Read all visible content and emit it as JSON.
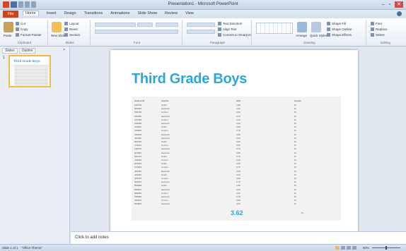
{
  "window": {
    "title": "Presentation1 - Microsoft PowerPoint",
    "controls": [
      "–",
      "▫",
      "✕"
    ]
  },
  "ribbon": {
    "file_tab": "File",
    "tabs": [
      "Home",
      "Insert",
      "Design",
      "Transitions",
      "Animations",
      "Slide Show",
      "Review",
      "View"
    ],
    "groups": {
      "clipboard": "Clipboard",
      "slides": "Slides",
      "font": "Font",
      "paragraph": "Paragraph",
      "drawing": "Drawing",
      "editing": "Editing"
    },
    "buttons": {
      "paste": "Paste",
      "cut": "Cut",
      "copy": "Copy",
      "format_painter": "Format Painter",
      "new_slide": "New Slide",
      "layout": "Layout",
      "reset": "Reset",
      "section": "Section",
      "text_direction": "Text Direction",
      "align_text": "Align Text",
      "convert_smartart": "Convert to SmartArt",
      "arrange": "Arrange",
      "quick_styles": "Quick Styles",
      "shape_fill": "Shape Fill",
      "shape_outline": "Shape Outline",
      "shape_effects": "Shape Effects",
      "find": "Find",
      "replace": "Replace",
      "select": "Select"
    }
  },
  "left_pane": {
    "tabs": [
      "Slides",
      "Outline"
    ],
    "close": "×",
    "slide_number": "1",
    "thumb_title": "Third Grade Boys"
  },
  "slide": {
    "title": "Third Grade Boys",
    "table": {
      "headers": [
        "Student ID",
        "Teacher",
        "GPA",
        "Gender"
      ],
      "rows": [
        [
          "128756",
          "Smith",
          "1.80",
          "M"
        ],
        [
          "854295",
          "Hancock",
          "4.00",
          "M"
        ],
        [
          "628786",
          "Conner",
          "3.80",
          "M"
        ],
        [
          "546085",
          "Hancock",
          "3.75",
          "M"
        ],
        [
          "247180",
          "Conner",
          "3.20",
          "M"
        ],
        [
          "229408",
          "Hancock",
          "4.00",
          "M"
        ],
        [
          "264852",
          "Smith",
          "3.80",
          "M"
        ],
        [
          "446853",
          "Conner",
          "3.75",
          "M"
        ],
        [
          "256608",
          "Hancock",
          "4.00",
          "M"
        ],
        [
          "462387",
          "Hancock",
          "3.20",
          "M"
        ],
        [
          "864236",
          "Smith",
          "3.80",
          "M"
        ],
        [
          "475623",
          "Conner",
          "3.80",
          "M"
        ],
        [
          "138752",
          "Hancock",
          "3.75",
          "M"
        ],
        [
          "907856",
          "Hancock",
          "3.80",
          "M"
        ],
        [
          "582475",
          "Smith",
          "3.75",
          "M"
        ],
        [
          "218683",
          "Conner",
          "3.20",
          "M"
        ],
        [
          "205463",
          "Smith",
          "4.00",
          "M"
        ],
        [
          "167863",
          "Conner",
          "3.75",
          "M"
        ],
        [
          "460585",
          "Hancock",
          "4.00",
          "M"
        ],
        [
          "243486",
          "Smith",
          "3.20",
          "M"
        ],
        [
          "464378",
          "Conner",
          "3.80",
          "M"
        ],
        [
          "864676",
          "Hancock",
          "3.75",
          "M"
        ],
        [
          "854688",
          "Smith",
          "1.80",
          "M"
        ],
        [
          "896801",
          "Hancock",
          "4.00",
          "M"
        ],
        [
          "880084",
          "Conner",
          "3.20",
          "M"
        ],
        [
          "338090",
          "Hancock",
          "3.75",
          "M"
        ],
        [
          "683623",
          "Conner",
          "3.80",
          "M"
        ],
        [
          "864806",
          "Hancock",
          "4.00",
          "M"
        ]
      ],
      "average": "3.62",
      "average_gender": "M"
    }
  },
  "notes": {
    "placeholder": "Click to add notes"
  },
  "status": {
    "slide": "Slide 1 of 1",
    "theme": "\"Office Theme\"",
    "zoom": "60%"
  }
}
